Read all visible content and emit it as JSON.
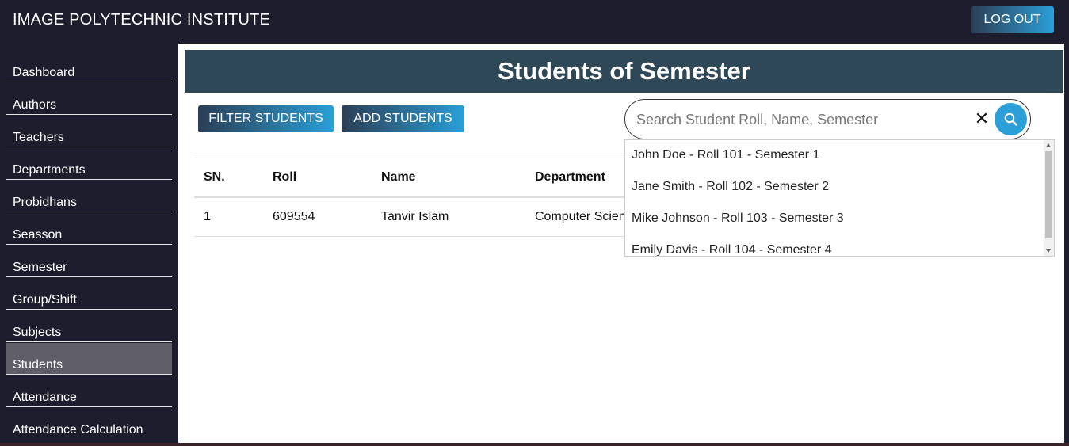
{
  "header": {
    "title": "IMAGE POLYTECHNIC INSTITUTE",
    "logout_label": "LOG OUT"
  },
  "sidebar": {
    "items": [
      {
        "label": "Dashboard"
      },
      {
        "label": "Authors"
      },
      {
        "label": "Teachers"
      },
      {
        "label": "Departments"
      },
      {
        "label": "Probidhans"
      },
      {
        "label": "Seasson"
      },
      {
        "label": "Semester"
      },
      {
        "label": "Group/Shift"
      },
      {
        "label": "Subjects"
      },
      {
        "label": "Students"
      },
      {
        "label": "Attendance"
      },
      {
        "label": "Attendance Calculation"
      }
    ],
    "active": "Students"
  },
  "main": {
    "page_title": "Students of Semester",
    "filter_label": "FILTER STUDENTS",
    "add_label": "ADD STUDENTS",
    "search": {
      "placeholder": "Search Student Roll, Name, Semester",
      "value": "",
      "clear_icon": "✕",
      "search_icon": "search-icon"
    },
    "suggestions": [
      "John Doe - Roll 101 - Semester 1",
      "Jane Smith - Roll 102 - Semester 2",
      "Mike Johnson - Roll 103 - Semester 3",
      "Emily Davis - Roll 104 - Semester 4"
    ],
    "table": {
      "columns": [
        "SN.",
        "Roll",
        "Name",
        "Department"
      ],
      "rows": [
        [
          "1",
          "609554",
          "Tanvir Islam",
          "Computer Scien"
        ]
      ]
    }
  },
  "colors": {
    "topbar": "#1e1d2e",
    "banner": "#2f4858",
    "accent": "#2a9fd8",
    "active_nav": "#5f5e68"
  }
}
